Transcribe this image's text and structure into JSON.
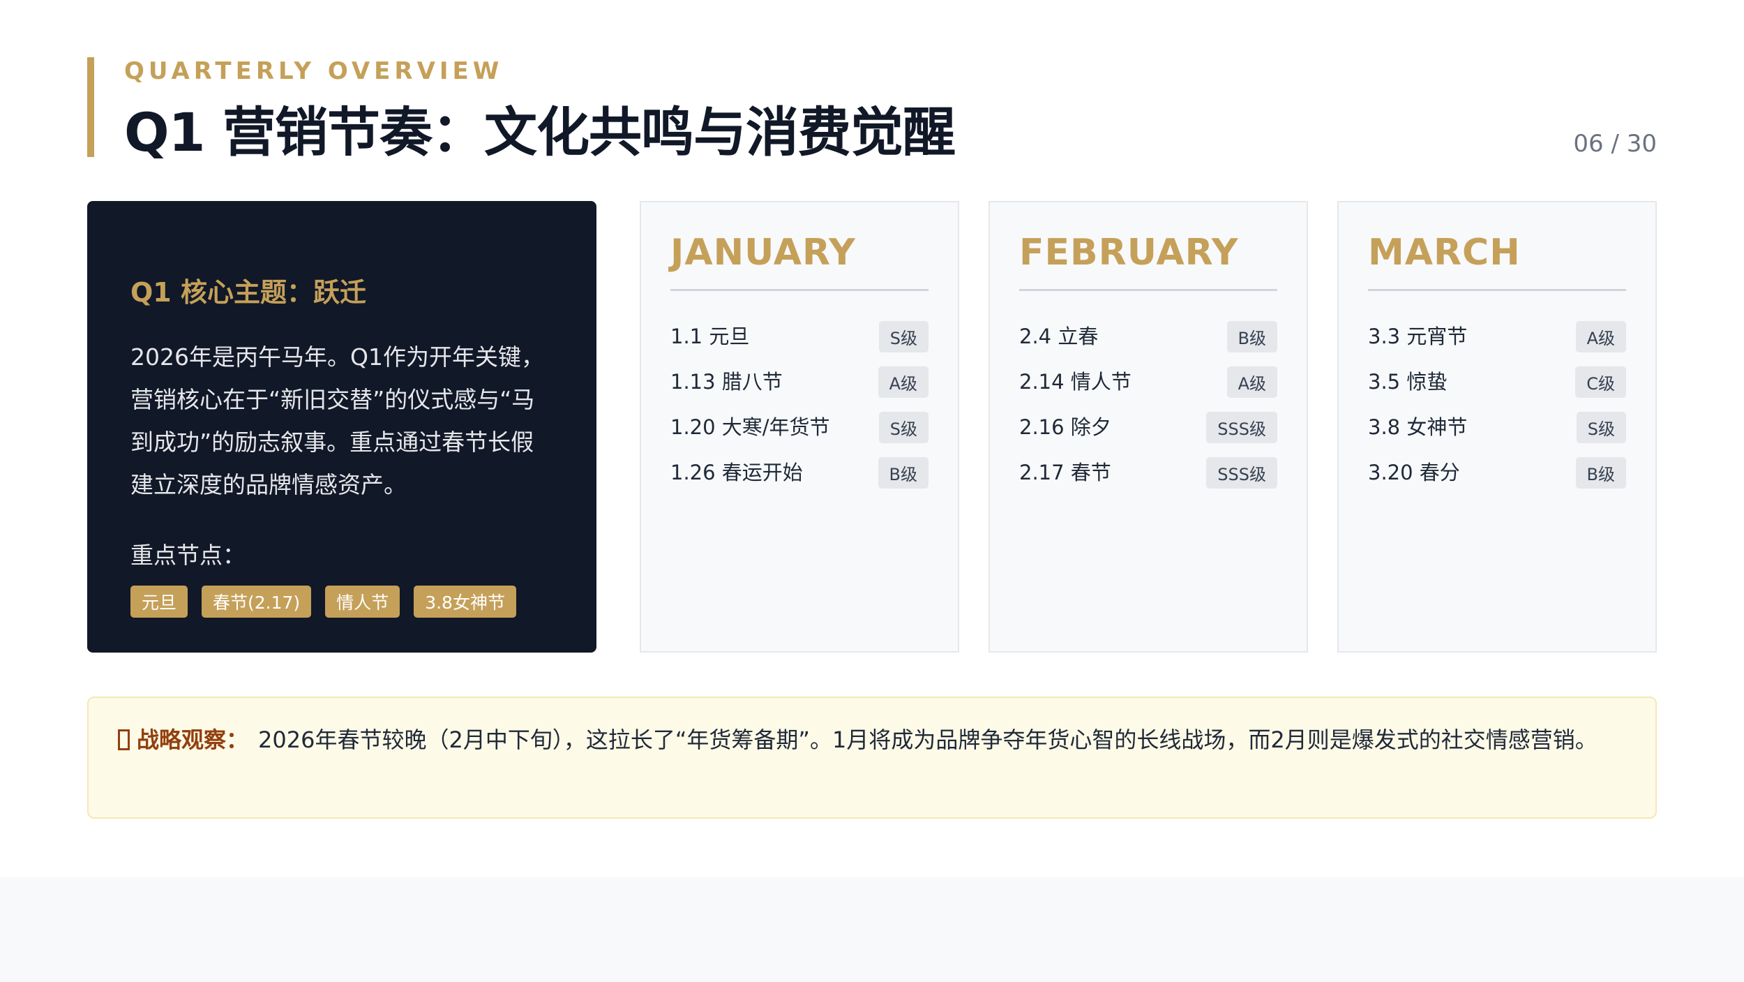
{
  "header": {
    "eyebrow": "QUARTERLY OVERVIEW",
    "title": "Q1 营销节奏：文化共鸣与消费觉醒",
    "page_number": "06 / 30"
  },
  "core": {
    "title": "Q1 核心主题：跃迁",
    "description": "2026年是丙午马年。Q1作为开年关键，营销核心在于“新旧交替”的仪式感与“马到成功”的励志叙事。重点通过春节长假建立深度的品牌情感资产。",
    "key_label": "重点节点：",
    "tags": [
      "元旦",
      "春节(2.17)",
      "情人节",
      "3.8女神节"
    ]
  },
  "months": [
    {
      "name": "JANUARY",
      "events": [
        {
          "name": "1.1 元旦",
          "grade": "S级"
        },
        {
          "name": "1.13 腊八节",
          "grade": "A级"
        },
        {
          "name": "1.20 大寒/年货节",
          "grade": "S级"
        },
        {
          "name": "1.26 春运开始",
          "grade": "B级"
        }
      ]
    },
    {
      "name": "FEBRUARY",
      "events": [
        {
          "name": "2.4 立春",
          "grade": "B级"
        },
        {
          "name": "2.14 情人节",
          "grade": "A级"
        },
        {
          "name": "2.16 除夕",
          "grade": "SSS级"
        },
        {
          "name": "2.17 春节",
          "grade": "SSS级"
        }
      ]
    },
    {
      "name": "MARCH",
      "events": [
        {
          "name": "3.3 元宵节",
          "grade": "A级"
        },
        {
          "name": "3.5 惊蛰",
          "grade": "C级"
        },
        {
          "name": "3.8 女神节",
          "grade": "S级"
        },
        {
          "name": "3.20 春分",
          "grade": "B级"
        }
      ]
    }
  ],
  "insight": {
    "icon": "lightbulb-icon",
    "label": "战略观察：",
    "text": "2026年春节较晚（2月中下旬），这拉长了“年货筹备期”。1月将成为品牌争夺年货心智的长线战场，而2月则是爆发式的社交情感营销。"
  },
  "colors": {
    "accent_gold": "#c5a059",
    "dark_navy": "#111827",
    "insight_bg": "#fefae8",
    "insight_label": "#92400e"
  }
}
